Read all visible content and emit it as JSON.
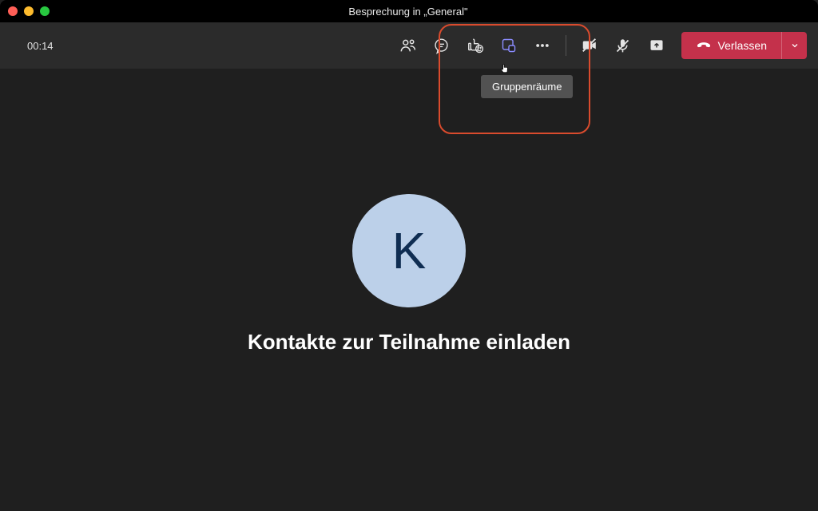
{
  "titlebar": {
    "title": "Besprechung in „General\""
  },
  "toolbar": {
    "timer": "00:14",
    "tooltip": "Gruppenräume",
    "leave_label": "Verlassen"
  },
  "icons": {
    "people": "people-icon",
    "chat": "chat-icon",
    "reactions": "reactions-icon",
    "rooms": "breakout-rooms-icon",
    "more": "more-options-icon",
    "camera": "camera-off-icon",
    "mic": "mic-off-icon",
    "share": "share-screen-icon",
    "phone": "hang-up-icon",
    "chevron": "chevron-down-icon"
  },
  "stage": {
    "avatar_initial": "K",
    "invite_text": "Kontakte zur Teilnahme einladen"
  },
  "colors": {
    "leave": "#c4314b",
    "annotation": "#d94b2d",
    "rooms_active": "#8b8cff"
  }
}
